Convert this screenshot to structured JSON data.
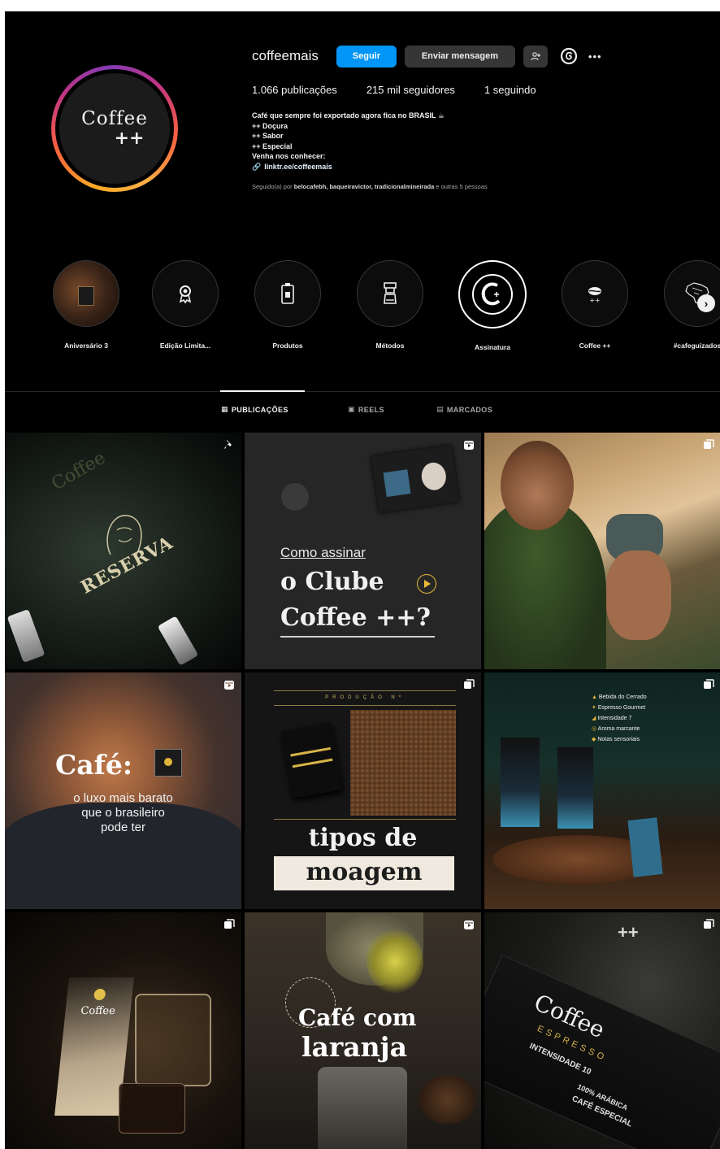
{
  "profile": {
    "username": "coffeemais",
    "follow_label": "Seguir",
    "message_label": "Enviar mensagem",
    "avatar_line1": "Coffee",
    "avatar_line2": "++",
    "stats": {
      "posts": "1.066 publicações",
      "followers": "215 mil seguidores",
      "following": "1 seguindo"
    },
    "bio": [
      "Café que sempre foi exportado agora fica no BRASIL ☕",
      "++ Doçura",
      "++ Sabor",
      "++ Especial",
      "Venha nos conhecer:"
    ],
    "link": "linktr.ee/coffeemais",
    "followed_by_prefix": "Seguido(a) por",
    "followed_by_names": "belocafebh, baqueiravictor, tradicionalmineirada",
    "followed_by_suffix": "e outras 5 pessoas"
  },
  "highlights": [
    {
      "label": "Aniversário 3",
      "icon": "photo-thumbnail"
    },
    {
      "label": "Edição Limita...",
      "icon": "award-icon"
    },
    {
      "label": "Produtos",
      "icon": "coffee-box-icon"
    },
    {
      "label": "Métodos",
      "icon": "coffee-maker-icon"
    },
    {
      "label": "Assinatura",
      "icon": "subscription-logo-icon"
    },
    {
      "label": "Coffee ++",
      "icon": "coffee-bean-icon"
    },
    {
      "label": "#cafeguizados",
      "icon": "brazil-map-icon"
    }
  ],
  "tabs": [
    {
      "label": "PUBLICAÇÕES",
      "active": true
    },
    {
      "label": "REELS",
      "active": false
    },
    {
      "label": "MARCADOS",
      "active": false
    }
  ],
  "posts": {
    "p1": {
      "text": "RESERVA",
      "badge": "pin-icon"
    },
    "p2": {
      "line1": "Como assinar",
      "line2": "o Clube",
      "line3": "Coffee ++?",
      "badge": "reel-icon"
    },
    "p3": {
      "badge": "carousel-icon"
    },
    "p4": {
      "line1": "Café:",
      "line2": "o luxo mais barato",
      "line3": "que o brasileiro",
      "line4": "pode ter",
      "badge": "reel-icon"
    },
    "p5": {
      "header": "PRODUÇÃO Nº",
      "line1": "tipos de",
      "line2": "moagem",
      "badge": "carousel-icon"
    },
    "p6": {
      "items": [
        "Bebida do Cerrado",
        "Espresso Gourmet",
        "Intensidade 7",
        "Aroma marcante",
        "Notas sensoriais"
      ],
      "badge": "carousel-icon"
    },
    "p7": {
      "text": "Coffee",
      "badge": "carousel-icon"
    },
    "p8": {
      "line1": "Café com",
      "line2": "laranja",
      "badge": "reel-icon"
    },
    "p9": {
      "brand": "Coffee",
      "plus": "++",
      "type": "ESPRESSO",
      "intensity": "INTENSIDADE 10",
      "tag": "100% ARÁBICA",
      "subtitle": "CAFÉ ESPECIAL",
      "badge": "carousel-icon"
    }
  },
  "colors": {
    "background": "#000000",
    "accent": "#0095f6",
    "button_secondary": "#363636"
  }
}
